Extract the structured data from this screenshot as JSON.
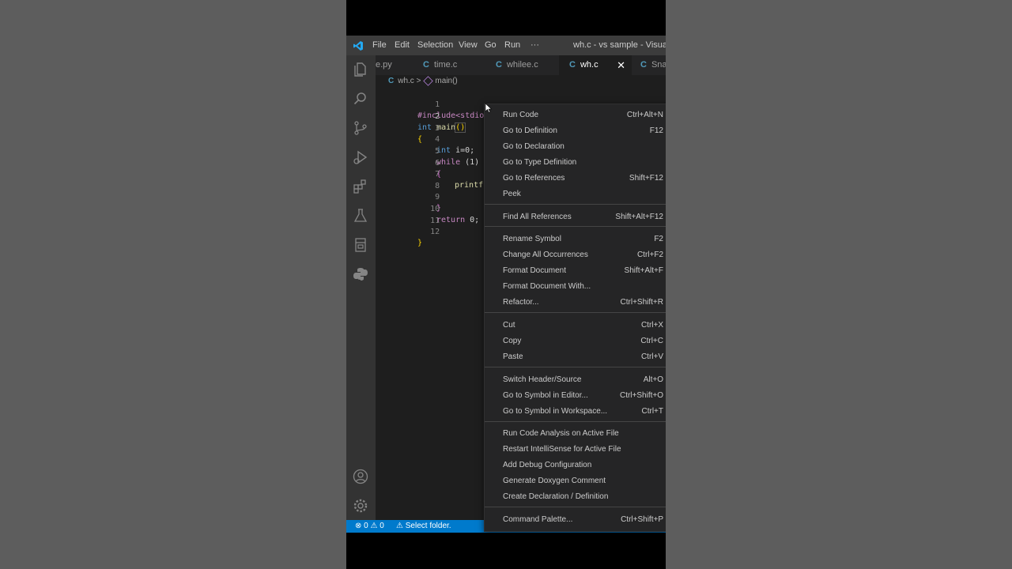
{
  "window": {
    "title": "wh.c - vs sample - Visual Stu",
    "menu": [
      "File",
      "Edit",
      "Selection",
      "View",
      "Go",
      "Run",
      "···"
    ]
  },
  "activity_icons": [
    "explorer-icon",
    "search-icon",
    "source-control-icon",
    "run-debug-icon",
    "extensions-icon",
    "testing-icon",
    "remote-explorer-icon",
    "python-icon",
    "account-icon",
    "settings-gear-icon"
  ],
  "tabs": [
    {
      "label": "e.py",
      "icon": ""
    },
    {
      "label": "time.c",
      "icon": "C"
    },
    {
      "label": "whilee.c",
      "icon": "C"
    },
    {
      "label": "wh.c",
      "icon": "C",
      "active": true
    },
    {
      "label": "Snal",
      "icon": "C"
    }
  ],
  "tab_close": "✕",
  "breadcrumb": {
    "file_icon": "C",
    "file": "wh.c",
    "separator": ">",
    "symbol": "main()"
  },
  "code_lines": [
    "1",
    "2",
    "3",
    "4",
    "5",
    "6",
    "7",
    "8",
    "9",
    "10",
    "11",
    "12"
  ],
  "code": {
    "l1": "#include<stdio.h>",
    "l2_kw": "int",
    "l2_fn": "main",
    "l2_paren": "()",
    "l3": "{",
    "l4_kw": "int",
    "l4_rest": " i=0;",
    "l5_kw": "while",
    "l5_rest": " (1)",
    "l6": "{",
    "l7": "printf",
    "l9": "}",
    "l10_kw": "return",
    "l10_rest": " 0;",
    "l12": "}"
  },
  "status": {
    "errors": "0",
    "warnings": "0",
    "folder": "Select folder."
  },
  "context_menu": [
    {
      "label": "Run Code",
      "shortcut": "Ctrl+Alt+N"
    },
    {
      "label": "Go to Definition",
      "shortcut": "F12"
    },
    {
      "label": "Go to Declaration",
      "shortcut": ""
    },
    {
      "label": "Go to Type Definition",
      "shortcut": ""
    },
    {
      "label": "Go to References",
      "shortcut": "Shift+F12"
    },
    {
      "label": "Peek",
      "shortcut": ""
    },
    {
      "label": "Find All References",
      "shortcut": "Shift+Alt+F12"
    },
    {
      "label": "Rename Symbol",
      "shortcut": "F2"
    },
    {
      "label": "Change All Occurrences",
      "shortcut": "Ctrl+F2"
    },
    {
      "label": "Format Document",
      "shortcut": "Shift+Alt+F"
    },
    {
      "label": "Format Document With...",
      "shortcut": ""
    },
    {
      "label": "Refactor...",
      "shortcut": "Ctrl+Shift+R"
    },
    {
      "label": "Cut",
      "shortcut": "Ctrl+X"
    },
    {
      "label": "Copy",
      "shortcut": "Ctrl+C"
    },
    {
      "label": "Paste",
      "shortcut": "Ctrl+V"
    },
    {
      "label": "Switch Header/Source",
      "shortcut": "Alt+O"
    },
    {
      "label": "Go to Symbol in Editor...",
      "shortcut": "Ctrl+Shift+O"
    },
    {
      "label": "Go to Symbol in Workspace...",
      "shortcut": "Ctrl+T"
    },
    {
      "label": "Run Code Analysis on Active File",
      "shortcut": ""
    },
    {
      "label": "Restart IntelliSense for Active File",
      "shortcut": ""
    },
    {
      "label": "Add Debug Configuration",
      "shortcut": ""
    },
    {
      "label": "Generate Doxygen Comment",
      "shortcut": ""
    },
    {
      "label": "Create Declaration / Definition",
      "shortcut": ""
    },
    {
      "label": "Command Palette...",
      "shortcut": "Ctrl+Shift+P"
    }
  ],
  "colors": {
    "accent": "#007acc",
    "tab_active_fg": "#ffffff",
    "c_icon": "#519aba"
  }
}
